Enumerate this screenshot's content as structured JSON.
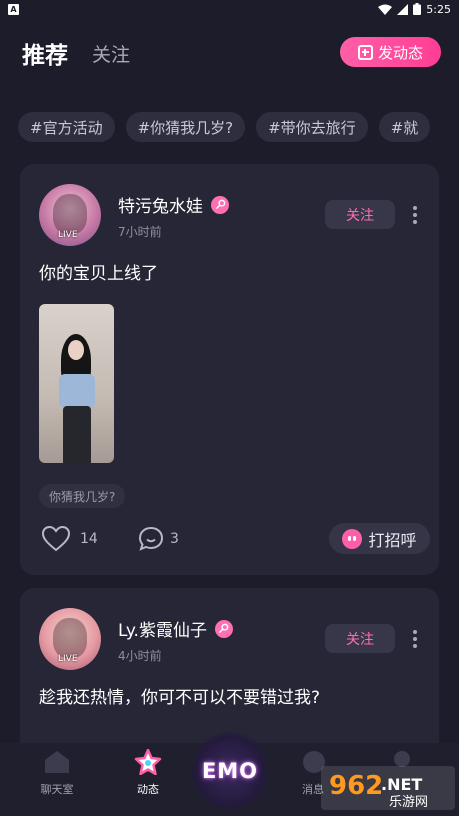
{
  "status_bar": {
    "app_icon_letter": "A",
    "time": "5:25"
  },
  "header": {
    "tab_recommend": "推荐",
    "tab_follow": "关注",
    "post_button_label": "发动态"
  },
  "topics": [
    "#官方活动",
    "#你猜我几岁?",
    "#带你去旅行",
    "#就"
  ],
  "posts": [
    {
      "username": "特污兔水娃",
      "time": "7小时前",
      "live_tag": "LIVE",
      "follow_label": "关注",
      "text": "你的宝贝上线了",
      "topic": "你猜我几岁?",
      "likes": "14",
      "comments": "3",
      "greet_label": "打招呼"
    },
    {
      "username": "Ly.紫霞仙子",
      "time": "4小时前",
      "live_tag": "LIVE",
      "follow_label": "关注",
      "text": "趁我还热情，你可不可以不要错过我?"
    }
  ],
  "bottom_nav": {
    "chat_label": "聊天室",
    "feed_label": "动态",
    "center_logo": "EMO",
    "msg_label": "消息",
    "me_label": ""
  },
  "watermark": {
    "brand": "962",
    "suffix": ".NET",
    "sub": "乐游网"
  },
  "colors": {
    "background": "#1c1c2b",
    "card": "#262637",
    "accent_pink": "#ff5fa8",
    "follow_text": "#ff6fb1"
  }
}
